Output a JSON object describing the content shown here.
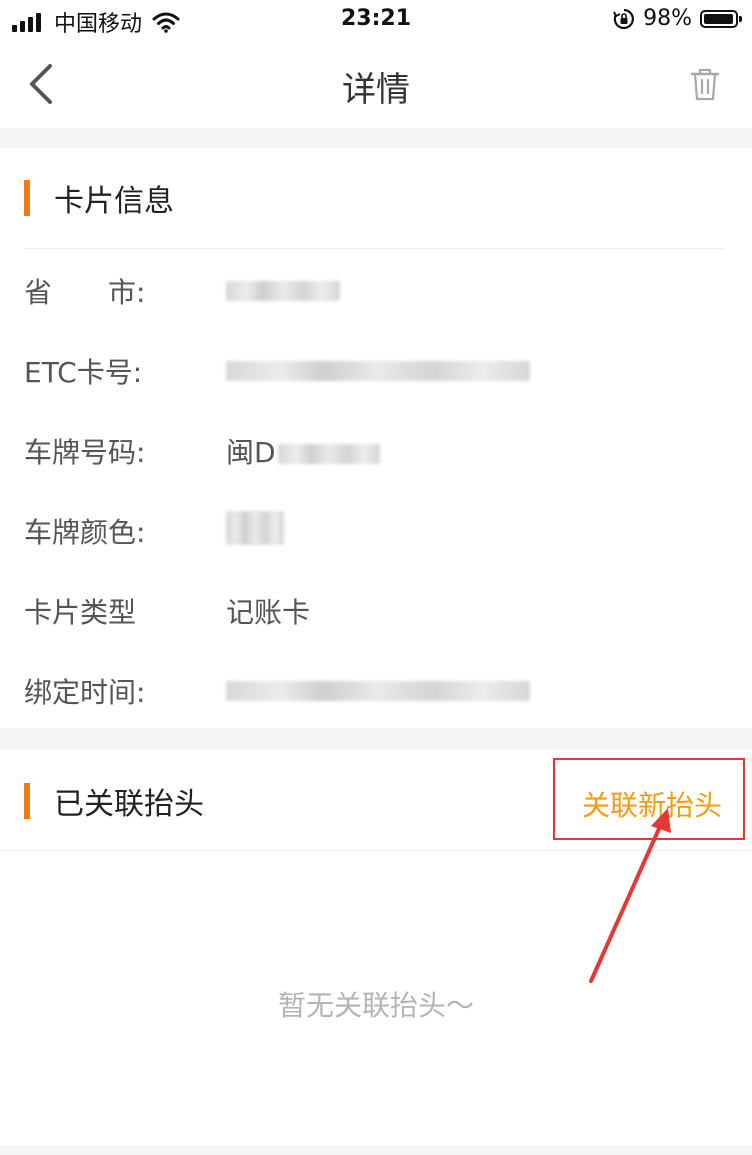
{
  "status_bar": {
    "carrier": "中国移动",
    "time": "23:21",
    "battery": "98%"
  },
  "nav": {
    "title": "详情",
    "back_icon": "chevron-left-icon",
    "trash_icon": "trash-icon"
  },
  "card_info": {
    "title": "卡片信息",
    "rows": [
      {
        "label": "省　　市:",
        "value": ""
      },
      {
        "label": "ETC卡号:",
        "value": ""
      },
      {
        "label": "车牌号码:",
        "value": "闽D"
      },
      {
        "label": "车牌颜色:",
        "value": ""
      },
      {
        "label": "卡片类型",
        "value": "记账卡"
      },
      {
        "label": "绑定时间:",
        "value": ""
      }
    ]
  },
  "linked": {
    "title": "已关联抬头",
    "action_label": "关联新抬头",
    "empty_text": "暂无关联抬头～"
  },
  "colors": {
    "accent": "#f07a18",
    "link": "#f39c12",
    "annotation": "#e23a33"
  }
}
